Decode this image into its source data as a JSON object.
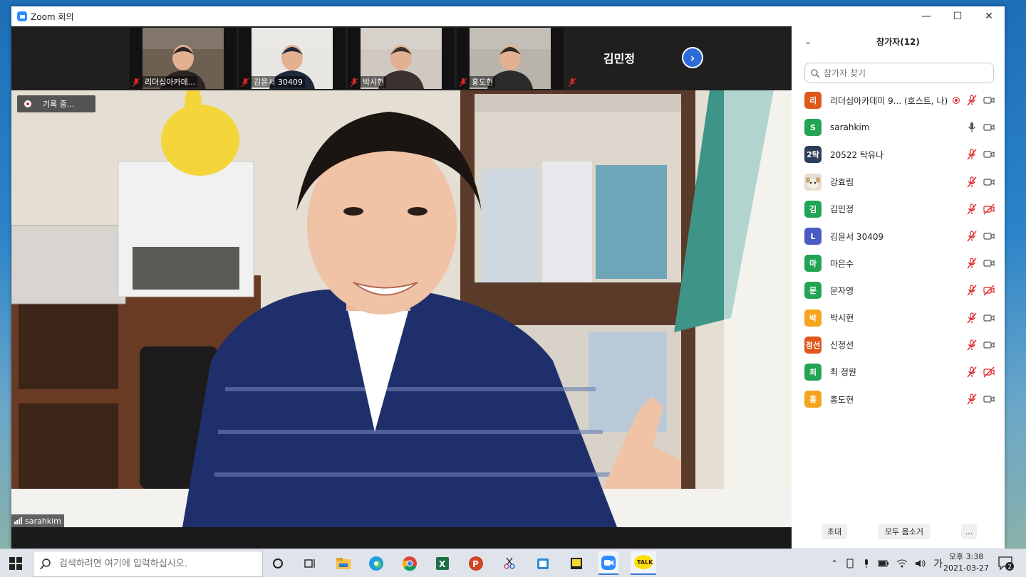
{
  "window": {
    "title": "Zoom 회의"
  },
  "window_controls": {
    "minimize": "—",
    "maximize": "☐",
    "close": "✕"
  },
  "thumbnails": [
    {
      "name": "리더십아카데...",
      "muted": true,
      "video": true,
      "bg": "#6d5f52",
      "person": "#2a2522"
    },
    {
      "name": "김윤서 30409",
      "muted": true,
      "video": true,
      "bg": "#e8e6e2",
      "person": "#1e2a3a"
    },
    {
      "name": "박시현",
      "muted": true,
      "video": true,
      "bg": "#cfc9c2",
      "person": "#3a3230"
    },
    {
      "name": "홍도현",
      "muted": true,
      "video": true,
      "bg": "#b9b4ab",
      "person": "#2b2b2b"
    },
    {
      "name": "김민정",
      "muted": true,
      "video": false
    }
  ],
  "recording": {
    "label": "기록 중..."
  },
  "active_speaker": {
    "name": "sarahkim"
  },
  "panel": {
    "title": "참가자(12)",
    "search_placeholder": "참가자 찾기",
    "participants": [
      {
        "avatar": "리",
        "color": "#e0571b",
        "name": "리더십아카데미 9... (호스트, 나)",
        "recording": true,
        "mic": "muted",
        "video": "on"
      },
      {
        "avatar": "S",
        "color": "#23a455",
        "name": "sarahkim",
        "recording": false,
        "mic": "on",
        "video": "on"
      },
      {
        "avatar": "2탁",
        "color": "#2c3e58",
        "name": "20522 탁유나",
        "recording": false,
        "mic": "muted",
        "video": "on"
      },
      {
        "avatar": "photo",
        "color": "#d8c8b0",
        "name": "강효림",
        "recording": false,
        "mic": "muted",
        "video": "on"
      },
      {
        "avatar": "김",
        "color": "#23a455",
        "name": "김민정",
        "recording": false,
        "mic": "muted",
        "video": "off"
      },
      {
        "avatar": "L",
        "color": "#4a5bc4",
        "name": "김윤서 30409",
        "recording": false,
        "mic": "muted",
        "video": "on"
      },
      {
        "avatar": "마",
        "color": "#23a455",
        "name": "마은수",
        "recording": false,
        "mic": "muted",
        "video": "on"
      },
      {
        "avatar": "문",
        "color": "#23a455",
        "name": "문자영",
        "recording": false,
        "mic": "muted",
        "video": "off"
      },
      {
        "avatar": "박",
        "color": "#f5a41c",
        "name": "박시현",
        "recording": false,
        "mic": "muted",
        "video": "on"
      },
      {
        "avatar": "정선",
        "color": "#e0571b",
        "name": "신정선",
        "recording": false,
        "mic": "muted",
        "video": "on"
      },
      {
        "avatar": "최",
        "color": "#23a455",
        "name": "최 정원",
        "recording": false,
        "mic": "muted",
        "video": "off"
      },
      {
        "avatar": "홍",
        "color": "#f5a41c",
        "name": "홍도현",
        "recording": false,
        "mic": "muted",
        "video": "on"
      }
    ],
    "footer": {
      "invite": "초대",
      "mute_all": "모두 음소거",
      "more": "..."
    }
  },
  "taskbar": {
    "search_placeholder": "검색하려면 여기에 입력하십시오.",
    "ime": "가",
    "time": "오후 3:38",
    "date": "2021-03-27",
    "notification_count": "2",
    "kakao_label": "TALK"
  },
  "colors": {
    "zoom_blue": "#2d8cff",
    "muted_red": "#e02828",
    "accent_blue": "#2d6bd6"
  }
}
